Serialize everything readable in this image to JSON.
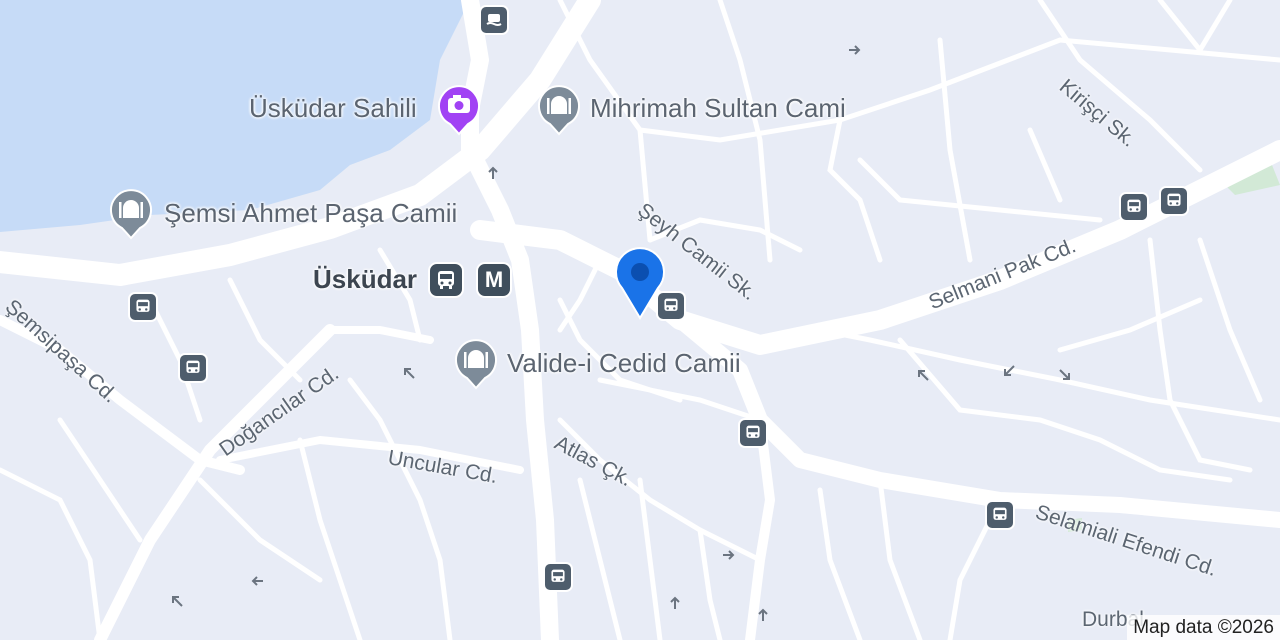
{
  "map": {
    "attribution": "Map data ©2026",
    "colors": {
      "land": "#e8ecf6",
      "water": "#c6dbf7",
      "road": "#ffffff",
      "pin": "#1a73e8",
      "transit_badge": "#4e5d6c",
      "photo_poi": "#a142f4",
      "mosque_poi": "#7d8b99",
      "park": "#d2e9d6"
    },
    "user_location_pin": {
      "icon": "location-pin-icon"
    },
    "places": [
      {
        "name": "Üsküdar Sahili",
        "icon": "camera-icon"
      },
      {
        "name": "Mihrimah Sultan Cami",
        "icon": "mosque-icon"
      },
      {
        "name": "Şemsi Ahmet Paşa Camii",
        "icon": "mosque-icon"
      },
      {
        "name": "Valide-i Cedid Camii",
        "icon": "mosque-icon"
      },
      {
        "name": "Üsküdar",
        "icon": "bus-icon",
        "metro_label": "M"
      }
    ],
    "streets": [
      "Şeyh Camii Sk.",
      "Selmani Pak Cd.",
      "Kirişçi Sk.",
      "Şemsipaşa Cd.",
      "Doğancılar Cd.",
      "Uncular Cd.",
      "Atlas Çk.",
      "Selamiali Efendi Cd.",
      "Durbal..."
    ],
    "transit_stops": [
      {
        "icon": "ferry-icon"
      },
      {
        "icon": "bus-icon"
      },
      {
        "icon": "bus-icon"
      },
      {
        "icon": "bus-icon"
      },
      {
        "icon": "bus-icon"
      },
      {
        "icon": "bus-icon"
      },
      {
        "icon": "bus-icon"
      },
      {
        "icon": "bus-icon"
      },
      {
        "icon": "bus-icon"
      }
    ]
  }
}
